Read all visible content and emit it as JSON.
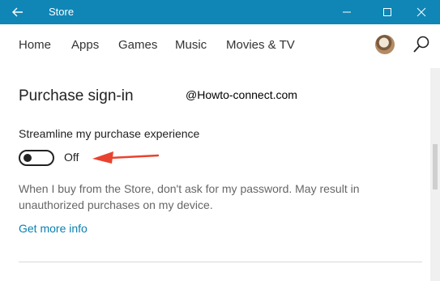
{
  "window": {
    "title": "Store",
    "accent_color": "#0f86b6"
  },
  "icons": {
    "back": "back-arrow-icon",
    "minimize": "minimize-icon",
    "maximize": "maximize-icon",
    "close": "close-icon",
    "search": "search-icon",
    "avatar": "user-avatar"
  },
  "nav": {
    "items": [
      "Home",
      "Apps",
      "Games",
      "Music",
      "Movies & TV"
    ]
  },
  "section": {
    "heading": "Purchase sign-in",
    "watermark": "@Howto-connect.com",
    "setting_label": "Streamline my purchase experience",
    "toggle_state": "Off",
    "toggle_on": false,
    "description": "When I buy from the Store, don't ask for my password. May result in unauthorized purchases on my device.",
    "link": "Get more info",
    "link_color": "#0a7fb0",
    "annotation_arrow_color": "#e8432f"
  }
}
